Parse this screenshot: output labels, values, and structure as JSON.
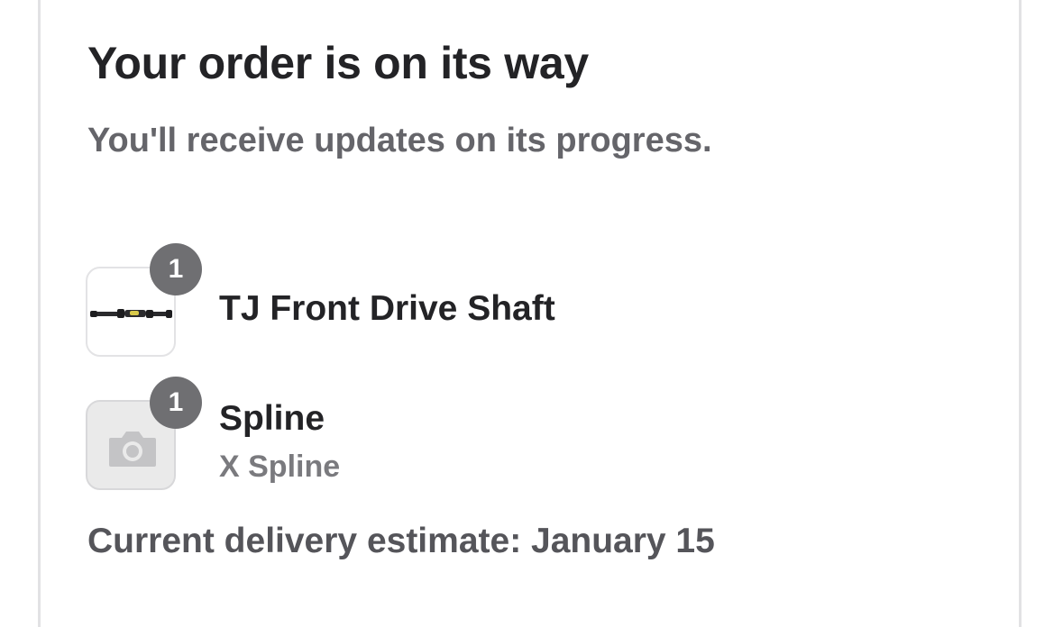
{
  "order_status": {
    "title": "Your order is on its way",
    "subtitle": "You'll receive updates on its progress."
  },
  "line_items": [
    {
      "name": "TJ Front Drive Shaft",
      "quantity": "1",
      "image": "drive-shaft-product-image"
    },
    {
      "name": "Spline",
      "variant": "X Spline",
      "quantity": "1",
      "image": "camera-placeholder-icon"
    }
  ],
  "delivery": {
    "estimate_text": "Current delivery estimate: January 15"
  },
  "colors": {
    "title": "#232326",
    "subtitle": "#65656a",
    "badge": "#6f6f72",
    "border": "#e2e2e4"
  }
}
